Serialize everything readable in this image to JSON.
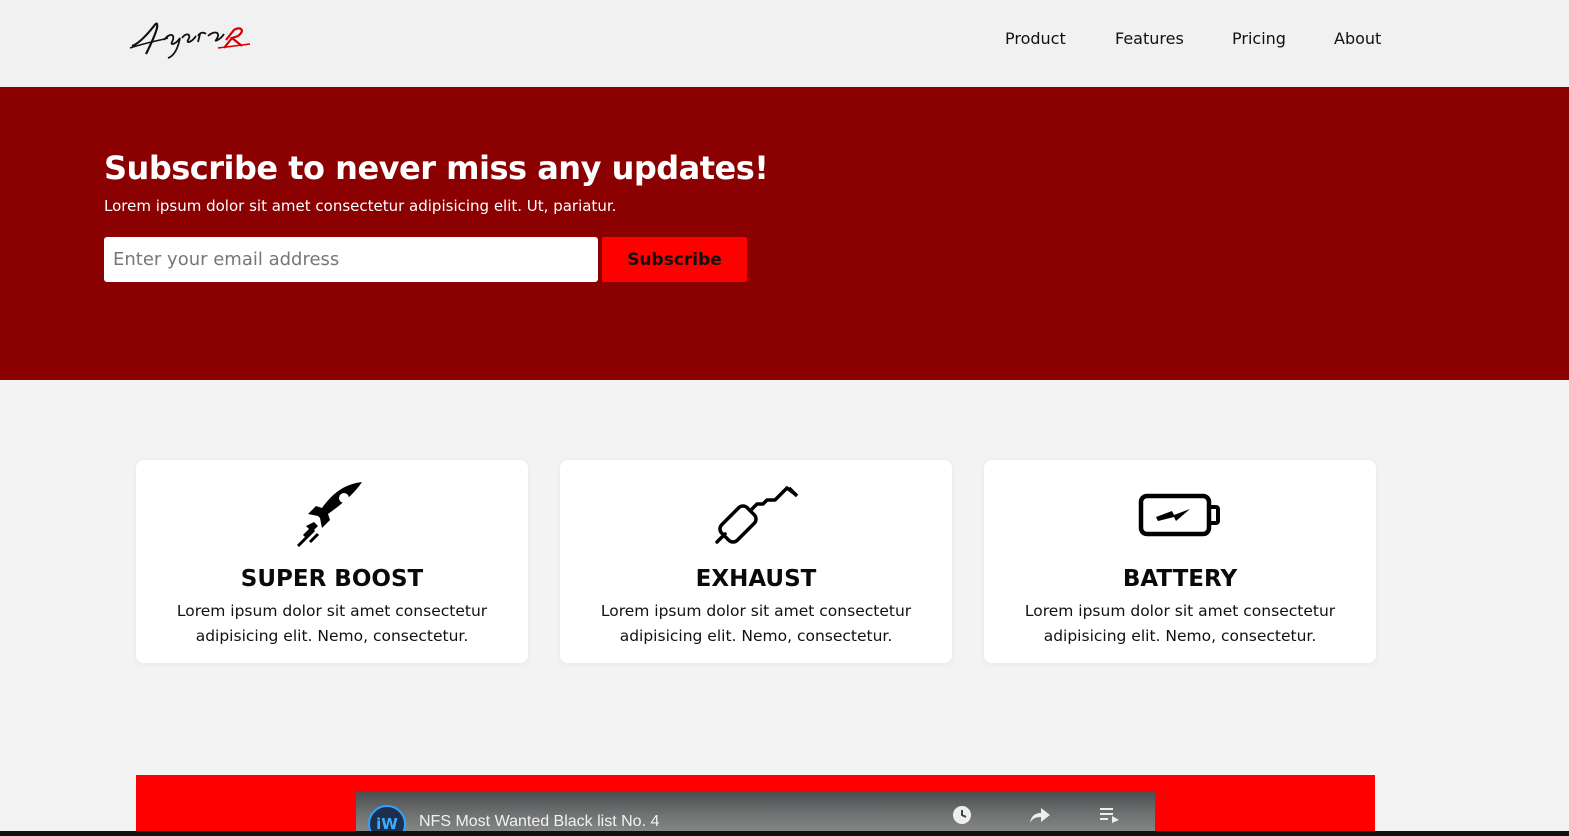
{
  "header": {
    "logo_text": "Agera R",
    "nav": [
      "Product",
      "Features",
      "Pricing",
      "About"
    ]
  },
  "hero": {
    "title": "Subscribe to never miss any updates!",
    "subtitle": "Lorem ipsum dolor sit amet consectetur adipisicing elit. Ut, pariatur.",
    "email_placeholder": "Enter your email address",
    "button_label": "Subscribe"
  },
  "features": [
    {
      "icon": "rocket-icon",
      "title": "SUPER BOOST",
      "text": "Lorem ipsum dolor sit amet consectetur adipisicing elit. Nemo, consectetur."
    },
    {
      "icon": "exhaust-icon",
      "title": "EXHAUST",
      "text": "Lorem ipsum dolor sit amet consectetur adipisicing elit. Nemo, consectetur."
    },
    {
      "icon": "battery-icon",
      "title": "BATTERY",
      "text": "Lorem ipsum dolor sit amet consectetur adipisicing elit. Nemo, consectetur."
    }
  ],
  "video": {
    "channel_icon": "iW",
    "title": "NFS Most Wanted Black list No. 4",
    "controls": [
      "watch-later-icon",
      "share-icon",
      "playlist-icon"
    ]
  },
  "colors": {
    "hero_bg": "#8b0000",
    "accent": "#ff0000",
    "page_bg": "#f3f3f3",
    "card_bg": "#ffffff"
  }
}
